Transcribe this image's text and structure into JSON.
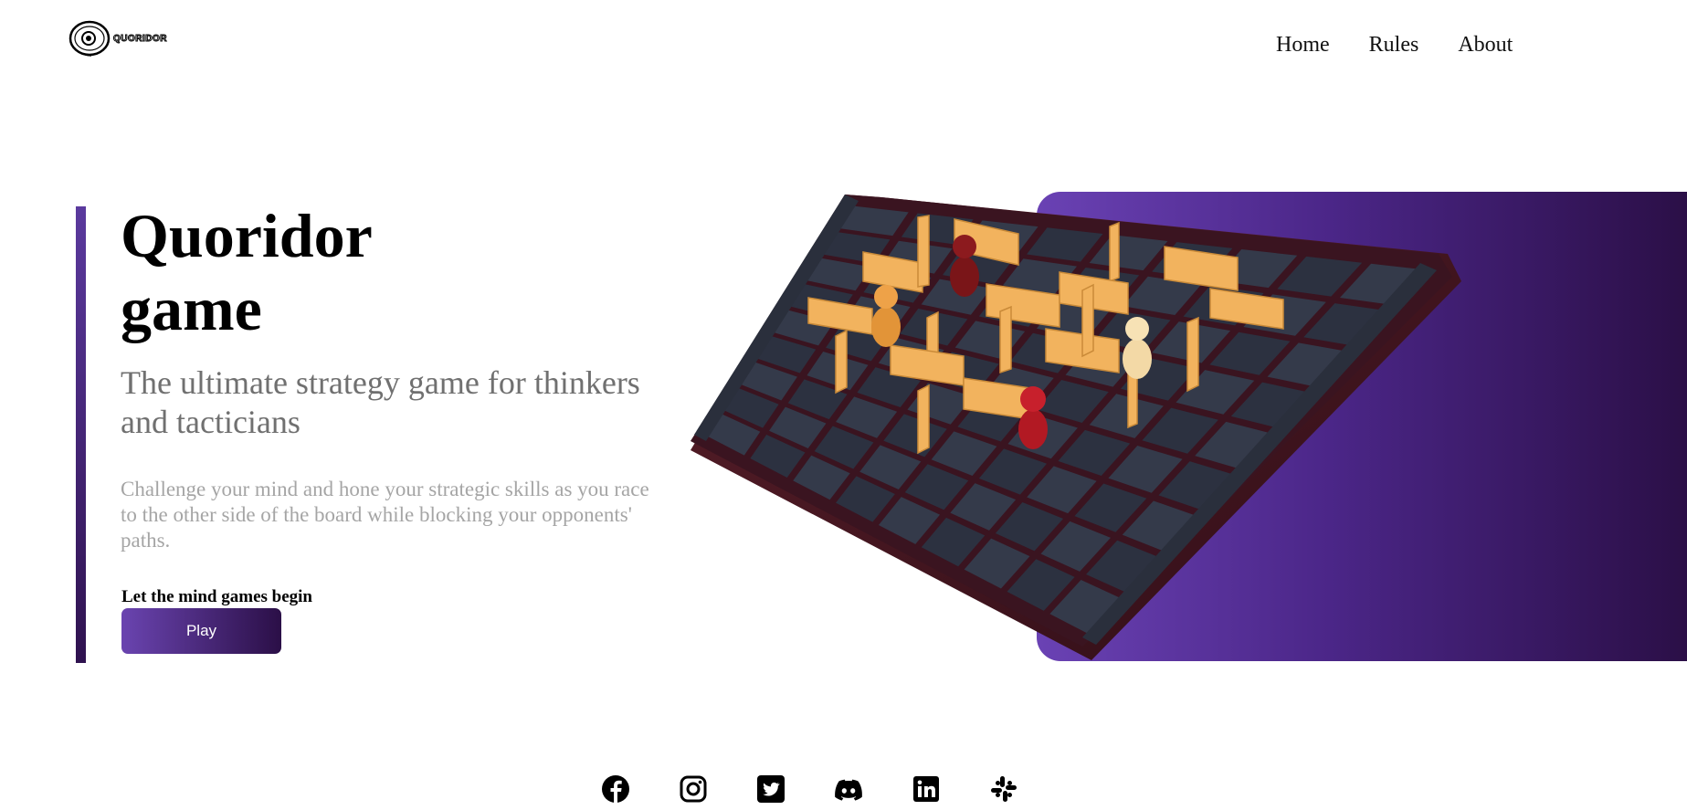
{
  "header": {
    "logo_text": "QUORIDOR",
    "nav": [
      {
        "label": "Home"
      },
      {
        "label": "Rules"
      },
      {
        "label": "About"
      }
    ]
  },
  "hero": {
    "title_line1": "Quoridor",
    "title_line2": "game",
    "subtitle": "The ultimate strategy game for thinkers and tacticians",
    "description": "Challenge your mind and hone your strategic skills as you race to the other side of the board while blocking your opponents' paths.",
    "cta_label": "Let the mind games begin",
    "play_button": "Play",
    "image": "quoridor-board-photo"
  },
  "social": [
    {
      "icon": "facebook-icon"
    },
    {
      "icon": "instagram-icon"
    },
    {
      "icon": "twitter-icon"
    },
    {
      "icon": "discord-icon"
    },
    {
      "icon": "linkedin-icon"
    },
    {
      "icon": "slack-icon"
    }
  ],
  "colors": {
    "accent_light": "#6a42b4",
    "accent_dark": "#2b0f47",
    "subtitle_text": "#707070",
    "description_text": "#a5a5a5"
  }
}
